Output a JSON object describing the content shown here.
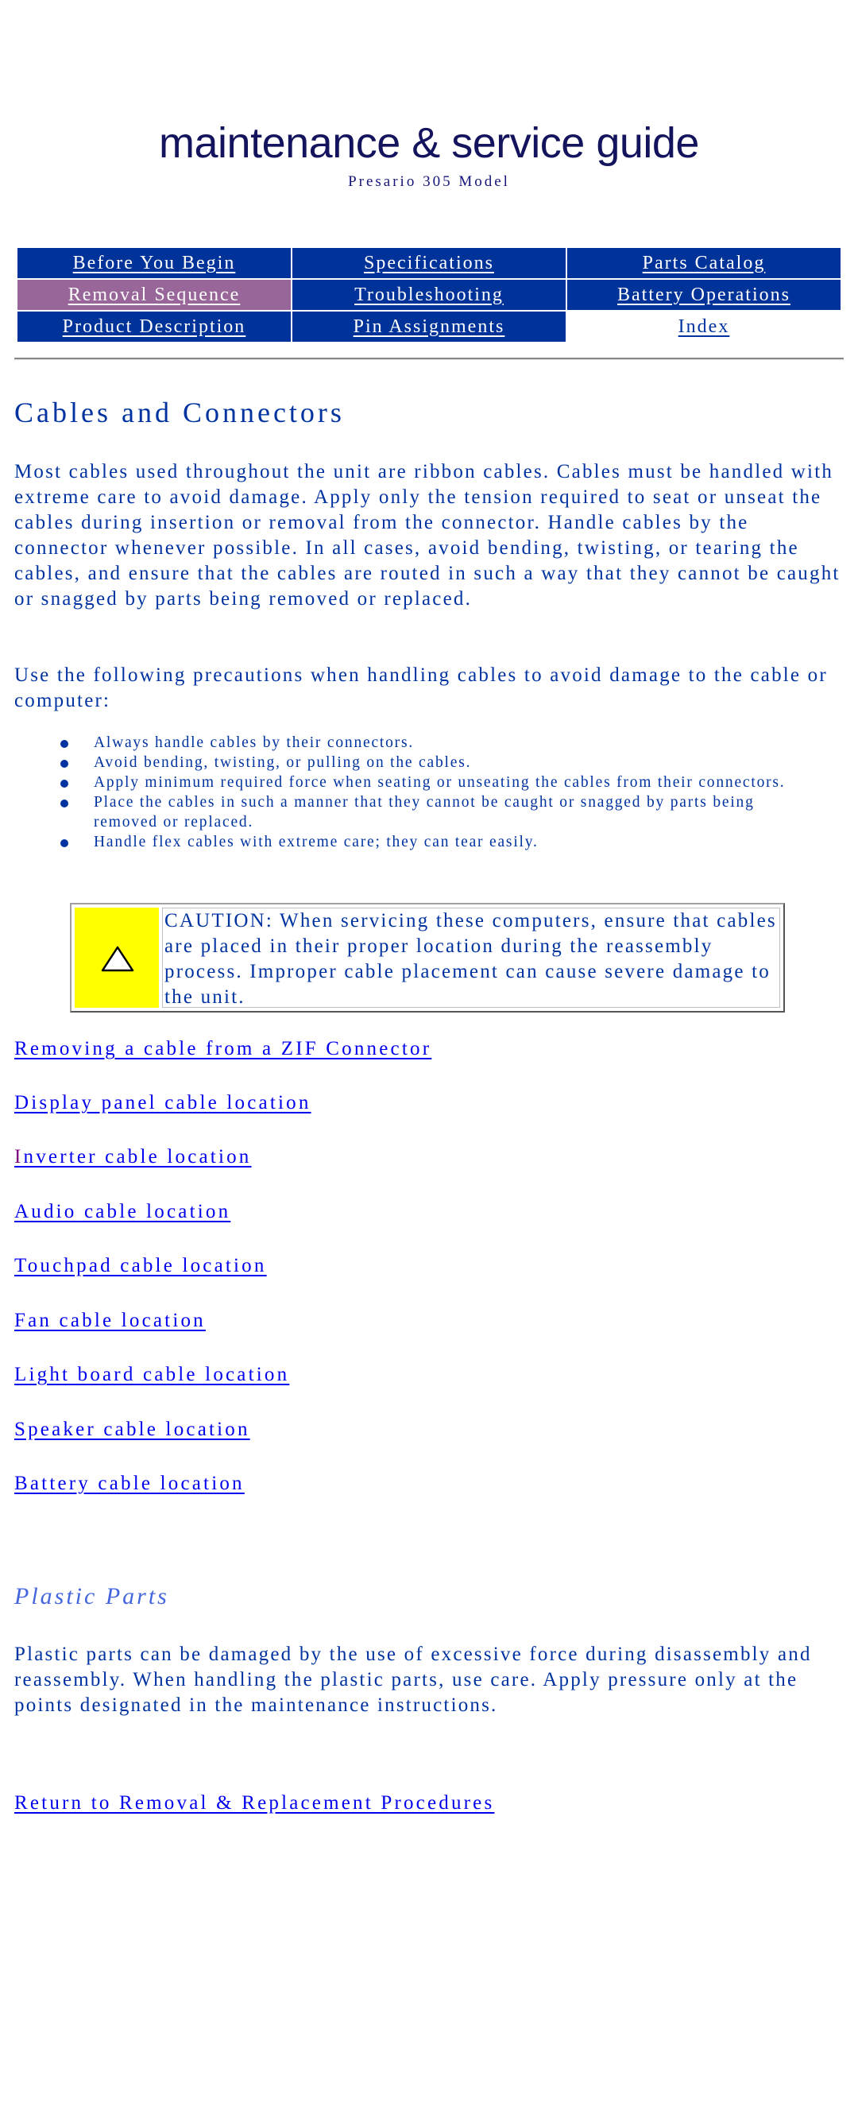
{
  "banner": {
    "title": "maintenance & service guide",
    "subtitle": "Presario 305 Model"
  },
  "nav": {
    "rows": [
      [
        {
          "label": "Before You Begin",
          "state": "normal"
        },
        {
          "label": "Specifications",
          "state": "normal"
        },
        {
          "label": "Parts Catalog",
          "state": "normal"
        }
      ],
      [
        {
          "label": "Removal Sequence",
          "state": "active"
        },
        {
          "label": "Troubleshooting",
          "state": "normal"
        },
        {
          "label": "Battery Operations",
          "state": "normal"
        }
      ],
      [
        {
          "label": "Product Description",
          "state": "normal"
        },
        {
          "label": "Pin Assignments",
          "state": "normal"
        },
        {
          "label": "Index",
          "state": "plain"
        }
      ]
    ],
    "colors": {
      "normal": "#003399",
      "active": "#996699",
      "plain": "#ffffff"
    }
  },
  "main": {
    "heading": "Cables and Connectors",
    "intro": "Most cables used throughout the unit are ribbon cables. Cables must be handled with extreme care to avoid damage. Apply only the tension required to seat or unseat the cables during insertion or removal from the connector. Handle cables by the connector whenever possible. In all cases, avoid bending, twisting, or tearing the cables, and ensure that the cables are routed in such a way that they cannot be caught or snagged by parts being removed or replaced.",
    "precautions_intro": "Use the following precautions when handling cables to avoid damage to the cable or computer:",
    "precautions": [
      "Always handle cables by their connectors.",
      "Avoid bending, twisting, or pulling on the cables.",
      "Apply minimum required force when seating or unseating the cables from their connectors.",
      "Place the cables in such a manner that they cannot be caught or snagged by parts being removed or replaced.",
      "Handle flex cables with extreme care; they can tear easily."
    ],
    "caution": {
      "icon": "warning-triangle-icon",
      "text": "CAUTION: When servicing these computers, ensure that cables are placed in their proper location during the reassembly process. Improper cable placement can cause severe damage to the unit.",
      "icon_bg": "#ffff00"
    },
    "links": [
      "Removing a cable from a ZIF Connector",
      "Display panel cable location",
      "Inverter cable location",
      "Audio cable location",
      "Touchpad cable location",
      "Fan cable location",
      "Light board cable location",
      "Speaker cable location",
      "Battery cable location"
    ],
    "plastic_heading": "Plastic Parts",
    "plastic_text": "Plastic parts can be damaged by the use of excessive force during disassembly and reassembly. When handling the plastic parts, use care. Apply pressure only at the points designated in the maintenance instructions.",
    "return_link": "Return to Removal & Replacement Procedures"
  },
  "colors": {
    "text": "#0033a0",
    "link": "#0000ee",
    "visited": "#800080",
    "subheading": "#4466dd"
  }
}
